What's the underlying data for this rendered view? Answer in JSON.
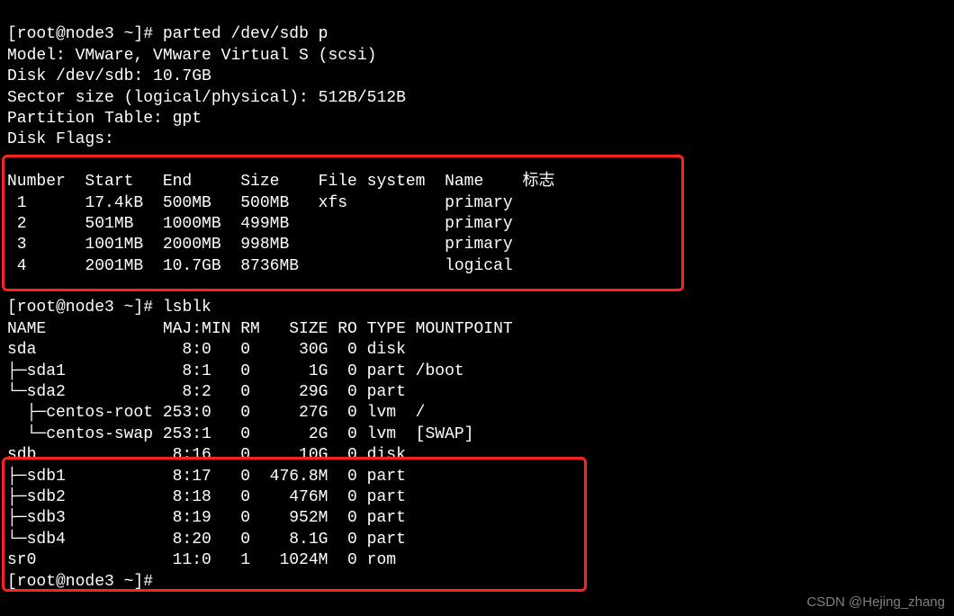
{
  "prompt1_prefix": "[root@node3 ~]",
  "prompt1_symbol": "# ",
  "command1": "parted /dev/sdb p",
  "info_lines": [
    "Model: VMware, VMware Virtual S (scsi)",
    "Disk /dev/sdb: 10.7GB",
    "Sector size (logical/physical): 512B/512B",
    "Partition Table: gpt",
    "Disk Flags:"
  ],
  "parted_header": {
    "number": "Number",
    "start": "Start",
    "end": "End",
    "size": "Size",
    "fs": "File system",
    "name": "Name",
    "flags": "标志"
  },
  "parted_rows": [
    {
      "number": " 1",
      "start": "17.4kB",
      "end": "500MB",
      "size": "500MB",
      "fs": "xfs",
      "name": "primary"
    },
    {
      "number": " 2",
      "start": "501MB",
      "end": "1000MB",
      "size": "499MB",
      "fs": "",
      "name": "primary"
    },
    {
      "number": " 3",
      "start": "1001MB",
      "end": "2000MB",
      "size": "998MB",
      "fs": "",
      "name": "primary"
    },
    {
      "number": " 4",
      "start": "2001MB",
      "end": "10.7GB",
      "size": "8736MB",
      "fs": "",
      "name": "logical"
    }
  ],
  "prompt2_prefix": "[root@node3 ~]",
  "prompt2_symbol": "# ",
  "command2": "lsblk",
  "lsblk_header": {
    "name": "NAME",
    "majmin": "MAJ:MIN",
    "rm": "RM",
    "size": "SIZE",
    "ro": "RO",
    "type": "TYPE",
    "mount": "MOUNTPOINT"
  },
  "lsblk_rows": [
    {
      "name": "sda",
      "majmin": "8:0",
      "rm": "0",
      "size": "30G",
      "ro": "0",
      "type": "disk",
      "mount": ""
    },
    {
      "name": "├─sda1",
      "majmin": "8:1",
      "rm": "0",
      "size": "1G",
      "ro": "0",
      "type": "part",
      "mount": "/boot"
    },
    {
      "name": "└─sda2",
      "majmin": "8:2",
      "rm": "0",
      "size": "29G",
      "ro": "0",
      "type": "part",
      "mount": ""
    },
    {
      "name": "  ├─centos-root",
      "majmin": "253:0",
      "rm": "0",
      "size": "27G",
      "ro": "0",
      "type": "lvm",
      "mount": "/"
    },
    {
      "name": "  └─centos-swap",
      "majmin": "253:1",
      "rm": "0",
      "size": "2G",
      "ro": "0",
      "type": "lvm",
      "mount": "[SWAP]"
    },
    {
      "name": "sdb",
      "majmin": "8:16",
      "rm": "0",
      "size": "10G",
      "ro": "0",
      "type": "disk",
      "mount": ""
    },
    {
      "name": "├─sdb1",
      "majmin": "8:17",
      "rm": "0",
      "size": "476.8M",
      "ro": "0",
      "type": "part",
      "mount": ""
    },
    {
      "name": "├─sdb2",
      "majmin": "8:18",
      "rm": "0",
      "size": "476M",
      "ro": "0",
      "type": "part",
      "mount": ""
    },
    {
      "name": "├─sdb3",
      "majmin": "8:19",
      "rm": "0",
      "size": "952M",
      "ro": "0",
      "type": "part",
      "mount": ""
    },
    {
      "name": "└─sdb4",
      "majmin": "8:20",
      "rm": "0",
      "size": "8.1G",
      "ro": "0",
      "type": "part",
      "mount": ""
    },
    {
      "name": "sr0",
      "majmin": "11:0",
      "rm": "1",
      "size": "1024M",
      "ro": "0",
      "type": "rom",
      "mount": ""
    }
  ],
  "prompt3_prefix": "[root@node3 ~]",
  "prompt3_symbol": "# ",
  "watermark": "CSDN @Hejing_zhang"
}
